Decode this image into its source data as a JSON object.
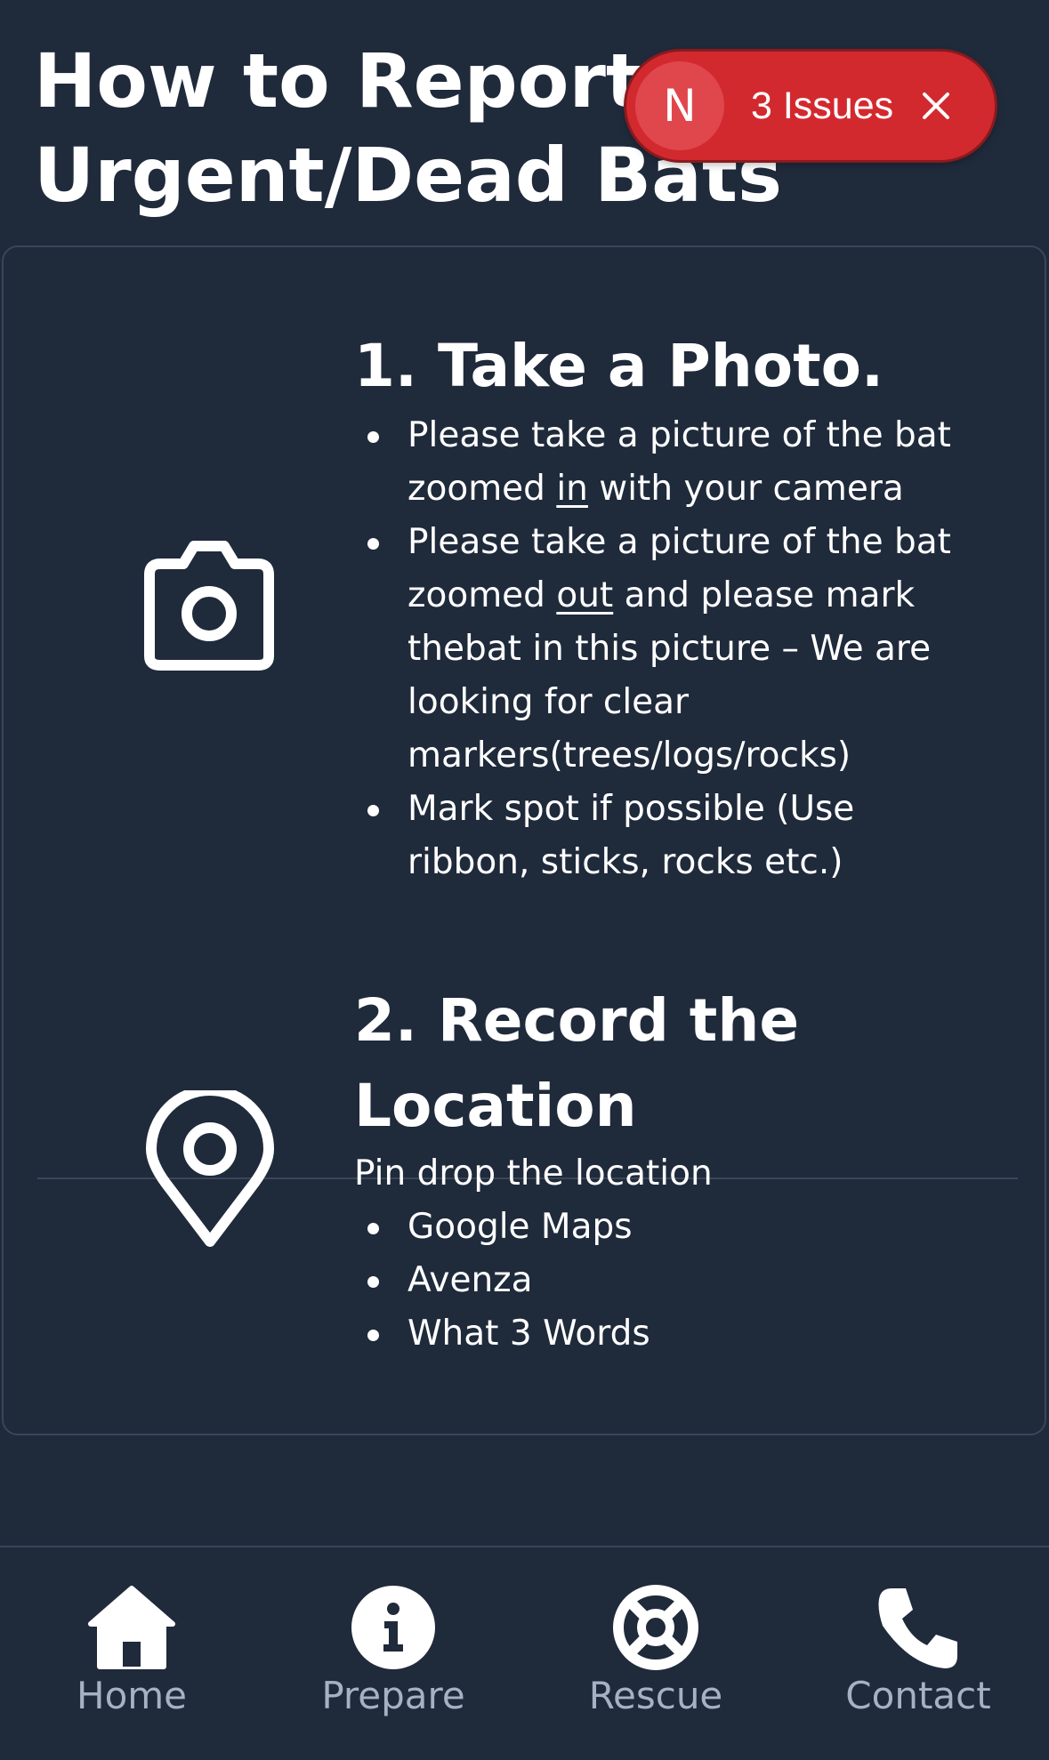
{
  "page": {
    "title": "How to Report Urgent/Dead Bats"
  },
  "issues_badge": {
    "letter": "N",
    "label": "3 Issues"
  },
  "steps": [
    {
      "icon": "camera-icon",
      "heading": "1. Take a Photo.",
      "bullets": [
        {
          "before": "Please take a picture of the bat zoomed ",
          "emphasis": "in",
          "after": " with your camera"
        },
        {
          "before": "Please take a picture of the bat zoomed ",
          "emphasis": "out",
          "after": " and please mark thebat in this picture – We are looking for clear markers(trees/logs/rocks)"
        },
        {
          "text": "Mark spot if possible (Use ribbon, sticks, rocks etc.)"
        }
      ]
    },
    {
      "icon": "map-pin-icon",
      "heading": "2. Record the Location",
      "intro": "Pin drop the location",
      "bullets": [
        {
          "text": "Google Maps"
        },
        {
          "text": "Avenza"
        },
        {
          "text": "What 3 Words"
        }
      ]
    }
  ],
  "nav": {
    "items": [
      {
        "label": "Home",
        "icon": "home-icon"
      },
      {
        "label": "Prepare",
        "icon": "info-icon"
      },
      {
        "label": "Rescue",
        "icon": "lifebuoy-icon"
      },
      {
        "label": "Contact",
        "icon": "phone-icon"
      }
    ]
  },
  "colors": {
    "background": "#1f2a3b",
    "border": "#3a4659",
    "badge": "#d2292f",
    "nav_label": "#a6b2c4",
    "text": "#ffffff"
  }
}
